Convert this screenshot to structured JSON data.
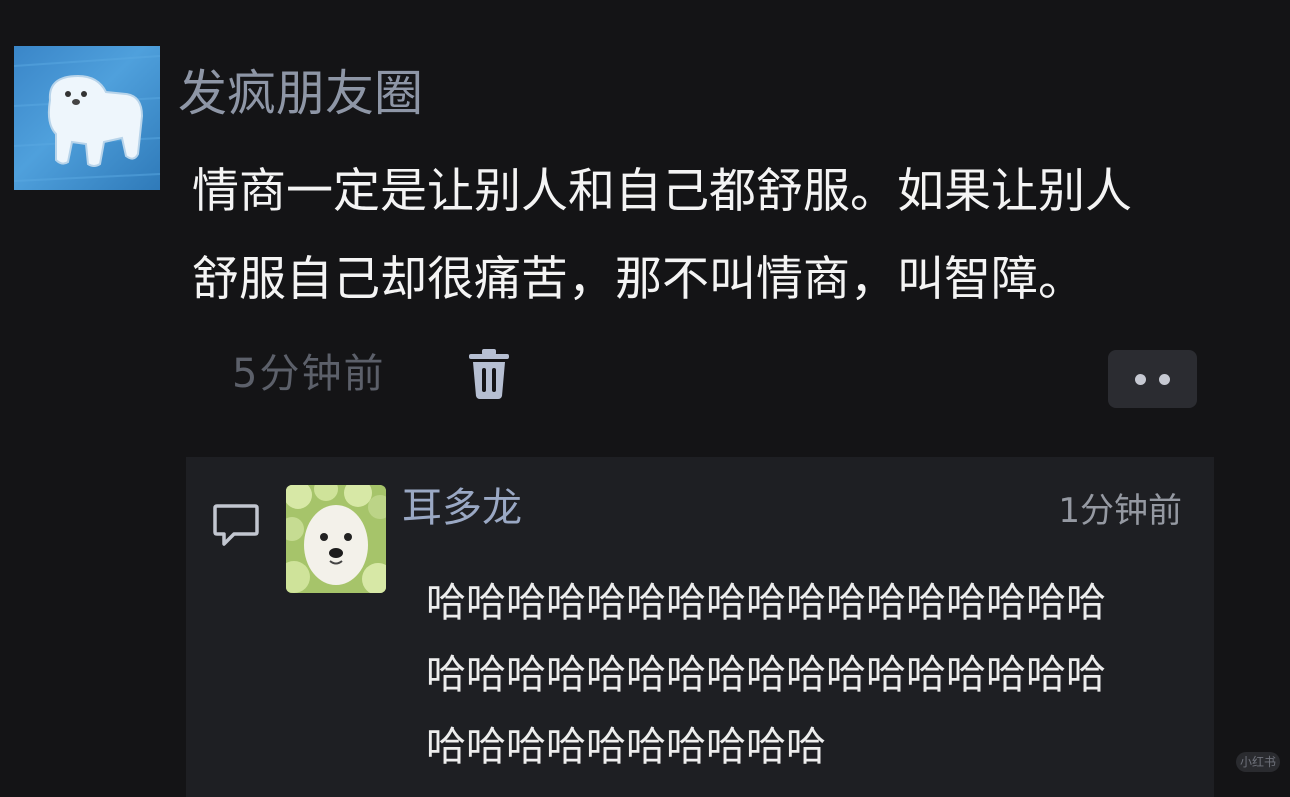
{
  "post": {
    "author": "发疯朋友圈",
    "text_lines": [
      "情商一定是让别人和自己都舒服。如果让别人",
      "舒服自己却很痛苦，那不叫情商，叫智障。"
    ],
    "time": "5分钟前"
  },
  "icons": {
    "delete": "trash-icon",
    "more": "more-dots-icon",
    "comment": "comment-icon"
  },
  "comment": {
    "author": "耳多龙",
    "time": "1分钟前",
    "text_lines": [
      "哈哈哈哈哈哈哈哈哈哈哈哈哈哈哈哈哈",
      "哈哈哈哈哈哈哈哈哈哈哈哈哈哈哈哈哈",
      "哈哈哈哈哈哈哈哈哈哈"
    ]
  },
  "watermark": "小红书",
  "colors": {
    "background": "#141416",
    "panel": "#1e1f23",
    "name_link": "#9aa8c4"
  }
}
